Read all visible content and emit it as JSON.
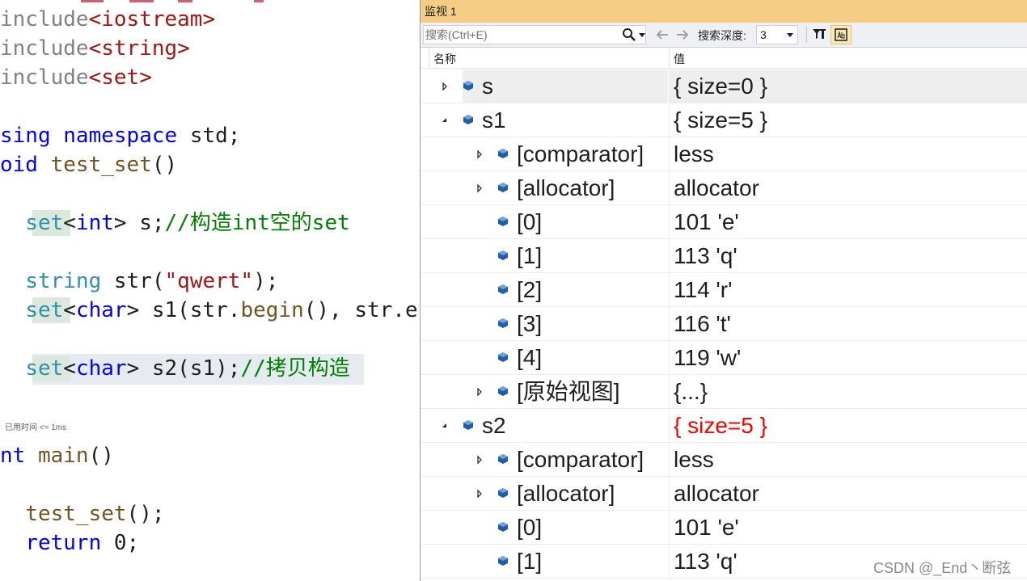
{
  "editor": {
    "codelens": "已用时间 <= 1ms",
    "lines": [
      {
        "parts": [
          [
            "inc",
            "include"
          ],
          [
            "str",
            "<iostream>"
          ]
        ]
      },
      {
        "parts": [
          [
            "inc",
            "include"
          ],
          [
            "str",
            "<string>"
          ]
        ]
      },
      {
        "parts": [
          [
            "inc",
            "include"
          ],
          [
            "str",
            "<set>"
          ]
        ]
      },
      {
        "parts": []
      },
      {
        "parts": [
          [
            "kw",
            "sing"
          ],
          [
            "pl",
            " "
          ],
          [
            "kw",
            "namespace"
          ],
          [
            "pl",
            " std;"
          ]
        ]
      },
      {
        "parts": [
          [
            "kw",
            "oid"
          ],
          [
            "pl",
            " "
          ],
          [
            "fn",
            "test_set"
          ],
          [
            "pl",
            "()"
          ]
        ]
      },
      {
        "parts": []
      },
      {
        "parts": [
          [
            "pl",
            "  "
          ],
          [
            "ty",
            "set"
          ],
          [
            "pl",
            "<"
          ],
          [
            "kw",
            "int"
          ],
          [
            "pl",
            "> s;"
          ],
          [
            "cm",
            "//构造int空的set"
          ]
        ]
      },
      {
        "parts": []
      },
      {
        "parts": [
          [
            "pl",
            "  "
          ],
          [
            "ty",
            "string"
          ],
          [
            "pl",
            " str("
          ],
          [
            "str",
            "\"qwert\""
          ],
          [
            "pl",
            ");"
          ]
        ]
      },
      {
        "parts": [
          [
            "pl",
            "  "
          ],
          [
            "ty",
            "set"
          ],
          [
            "pl",
            "<"
          ],
          [
            "kw",
            "char"
          ],
          [
            "pl",
            "> s1(str."
          ],
          [
            "fn",
            "begin"
          ],
          [
            "pl",
            "(), str.en"
          ]
        ]
      },
      {
        "parts": []
      },
      {
        "parts": [
          [
            "pl",
            "  "
          ],
          [
            "ty",
            "set"
          ],
          [
            "pl",
            "<"
          ],
          [
            "kw",
            "char"
          ],
          [
            "pl",
            "> s2(s1);"
          ],
          [
            "cm",
            "//拷贝构造"
          ]
        ]
      },
      {
        "parts": []
      },
      {
        "parts": []
      },
      {
        "parts": [
          [
            "kw",
            "nt"
          ],
          [
            "pl",
            " "
          ],
          [
            "fn",
            "main"
          ],
          [
            "pl",
            "()"
          ]
        ]
      },
      {
        "parts": []
      },
      {
        "parts": [
          [
            "pl",
            "  "
          ],
          [
            "fn",
            "test_set"
          ],
          [
            "pl",
            "();"
          ]
        ]
      },
      {
        "parts": [
          [
            "pl",
            "  "
          ],
          [
            "kw",
            "return"
          ],
          [
            "pl",
            " 0;"
          ]
        ]
      }
    ]
  },
  "watch": {
    "title": "监视 1",
    "search_placeholder": "搜索(Ctrl+E)",
    "depth_label": "搜索深度:",
    "depth_value": "3",
    "col_name": "名称",
    "col_value": "值",
    "rows": [
      {
        "name": "s",
        "value": "{ size=0 }",
        "level": 0,
        "expander": "collapsed",
        "selected": true,
        "changed": false
      },
      {
        "name": "s1",
        "value": "{ size=5 }",
        "level": 0,
        "expander": "expanded",
        "selected": false,
        "changed": false
      },
      {
        "name": "[comparator]",
        "value": "less",
        "level": 1,
        "expander": "collapsed",
        "selected": false,
        "changed": false
      },
      {
        "name": "[allocator]",
        "value": "allocator",
        "level": 1,
        "expander": "collapsed",
        "selected": false,
        "changed": false
      },
      {
        "name": "[0]",
        "value": "101 'e'",
        "level": 1,
        "expander": "none",
        "selected": false,
        "changed": false
      },
      {
        "name": "[1]",
        "value": "113 'q'",
        "level": 1,
        "expander": "none",
        "selected": false,
        "changed": false
      },
      {
        "name": "[2]",
        "value": "114 'r'",
        "level": 1,
        "expander": "none",
        "selected": false,
        "changed": false
      },
      {
        "name": "[3]",
        "value": "116 't'",
        "level": 1,
        "expander": "none",
        "selected": false,
        "changed": false
      },
      {
        "name": "[4]",
        "value": "119 'w'",
        "level": 1,
        "expander": "none",
        "selected": false,
        "changed": false
      },
      {
        "name": "[原始视图]",
        "value": "{...}",
        "level": 1,
        "expander": "collapsed",
        "selected": false,
        "changed": false
      },
      {
        "name": "s2",
        "value": "{ size=5 }",
        "level": 0,
        "expander": "expanded",
        "selected": false,
        "changed": true
      },
      {
        "name": "[comparator]",
        "value": "less",
        "level": 1,
        "expander": "collapsed",
        "selected": false,
        "changed": false
      },
      {
        "name": "[allocator]",
        "value": "allocator",
        "level": 1,
        "expander": "collapsed",
        "selected": false,
        "changed": false
      },
      {
        "name": "[0]",
        "value": "101 'e'",
        "level": 1,
        "expander": "none",
        "selected": false,
        "changed": false
      },
      {
        "name": "[1]",
        "value": "113 'q'",
        "level": 1,
        "expander": "none",
        "selected": false,
        "changed": false
      }
    ]
  },
  "watermark": "CSDN @_End丶断弦",
  "colors": {
    "title_bar": "#f5cc84",
    "changed_value": "#ff0000",
    "object_icon": "#1e5fa8"
  },
  "icons": [
    "search-icon",
    "back-arrow-icon",
    "forward-arrow-icon",
    "filter-icon",
    "hex-display-icon",
    "expander-icon",
    "object-icon"
  ]
}
